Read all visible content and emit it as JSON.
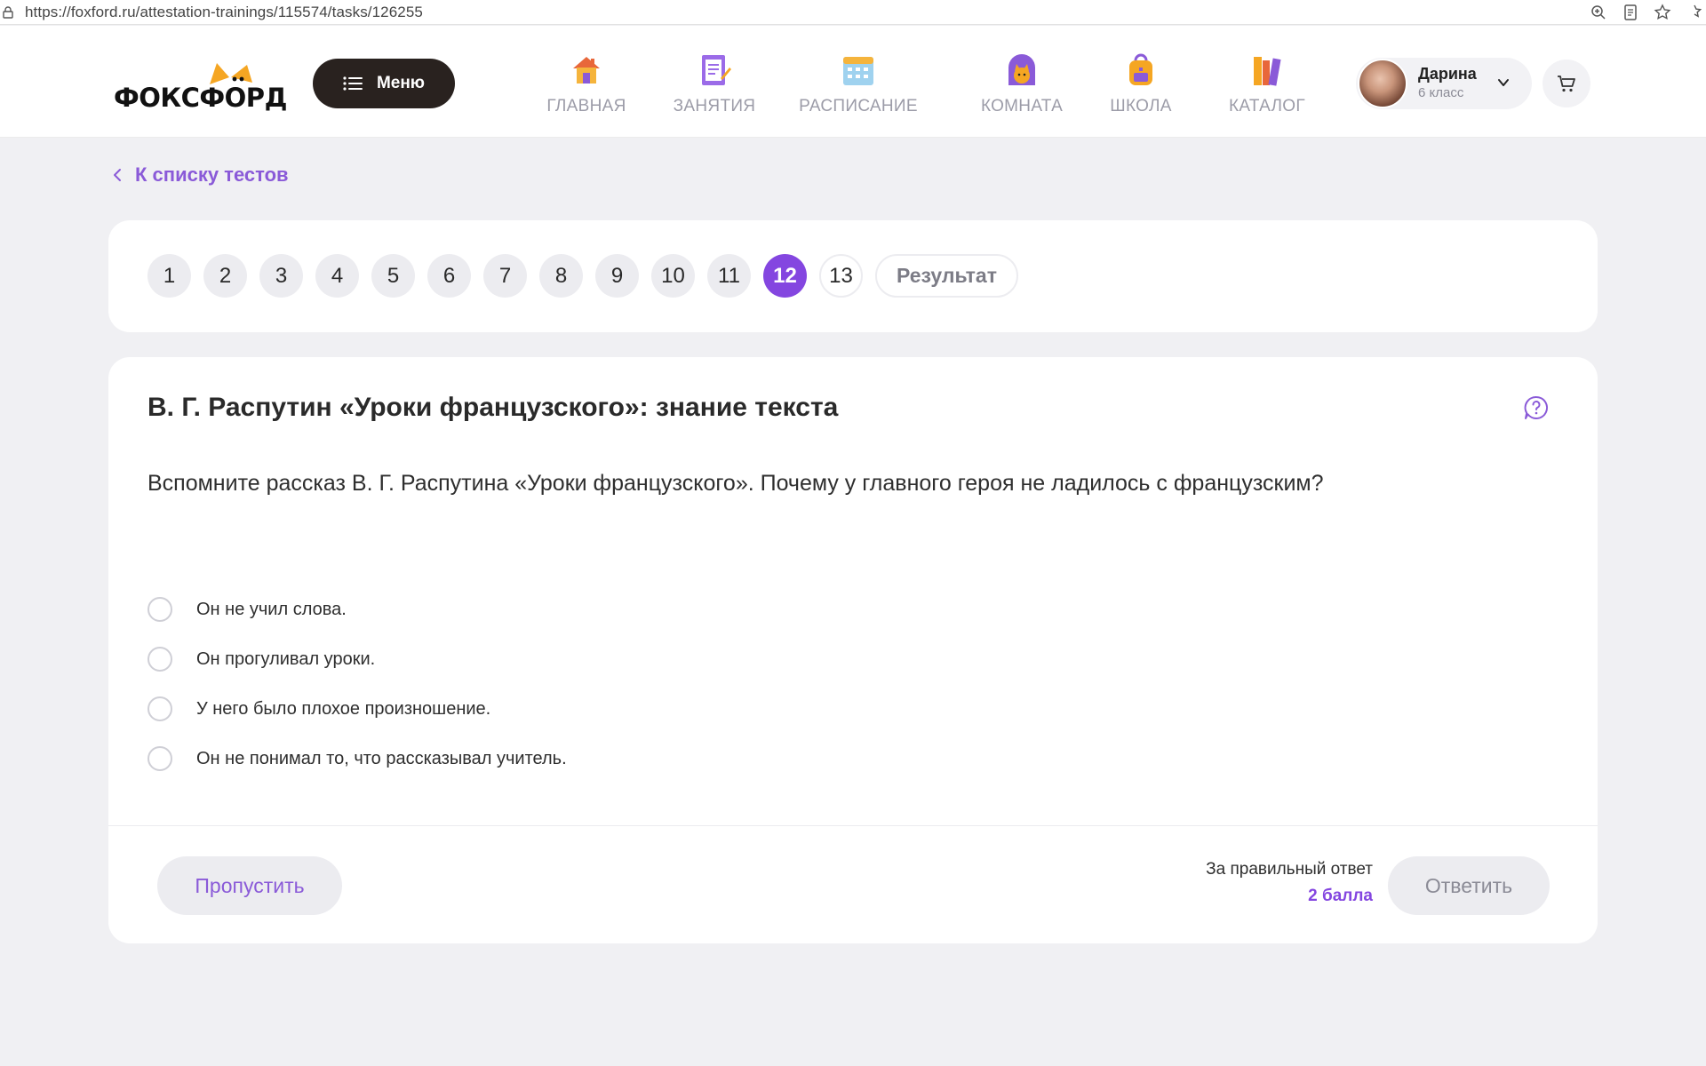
{
  "browser": {
    "url": "https://foxford.ru/attestation-trainings/115574/tasks/126255"
  },
  "header": {
    "logo_text": "ФОКСФОРД",
    "menu_label": "Меню",
    "nav": [
      {
        "label": "ГЛАВНАЯ",
        "icon": "house-icon"
      },
      {
        "label": "ЗАНЯТИЯ",
        "icon": "notepad-icon"
      },
      {
        "label": "РАСПИСАНИЕ",
        "icon": "calendar-icon"
      },
      {
        "label": "КОМНАТА",
        "icon": "fox-room-icon"
      },
      {
        "label": "ШКОЛА",
        "icon": "backpack-icon"
      },
      {
        "label": "КАТАЛОГ",
        "icon": "books-icon"
      }
    ],
    "user": {
      "name": "Дарина",
      "grade": "6 класс"
    }
  },
  "back_link": "К списку тестов",
  "pager": {
    "pages": [
      "1",
      "2",
      "3",
      "4",
      "5",
      "6",
      "7",
      "8",
      "9",
      "10",
      "11",
      "12",
      "13"
    ],
    "current": "12",
    "result_label": "Результат"
  },
  "question": {
    "title": "В. Г. Распутин «Уроки французского»: знание текста",
    "text": "Вспомните рассказ В. Г. Распутина «Уроки французского». Почему у главного героя не ладилось с французским?",
    "options": [
      "Он не учил слова.",
      "Он прогуливал уроки.",
      "У него было плохое произношение.",
      "Он не понимал то, что рассказывал учитель."
    ]
  },
  "footer": {
    "skip_label": "Пропустить",
    "reward_label": "За правильный ответ",
    "reward_value": "2 балла",
    "answer_label": "Ответить"
  },
  "colors": {
    "accent": "#8446e0",
    "link": "#8a5ad8",
    "background": "#f0f0f3",
    "menu_button": "#29221f"
  }
}
